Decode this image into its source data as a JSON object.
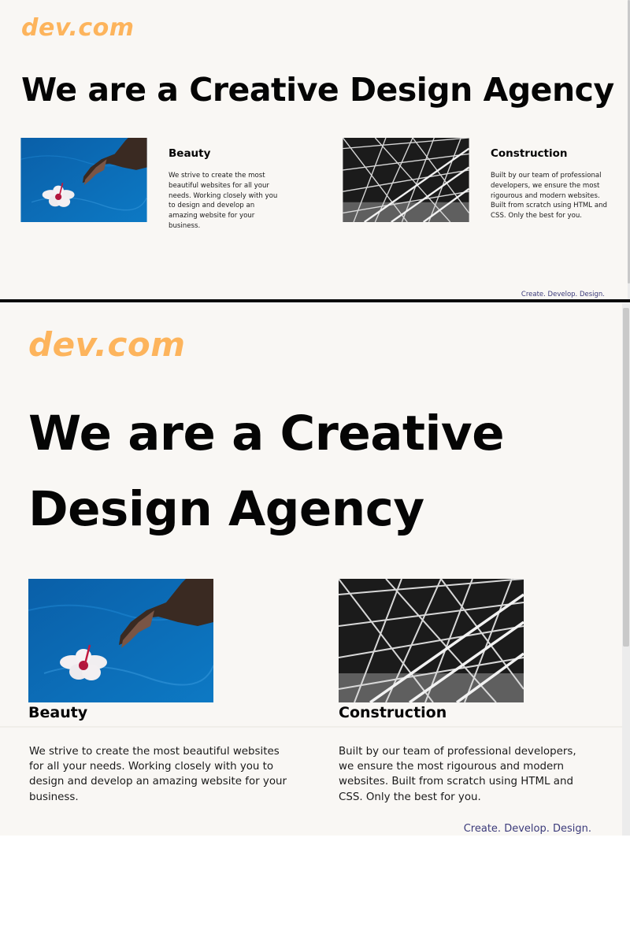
{
  "site": {
    "logo": "dev.com",
    "headline": "We are a Creative Design Agency",
    "tagline": "Create. Develop. Design.",
    "colors": {
      "logo": "#fdb45c",
      "background": "#f9f7f4",
      "tagline": "#3b3a7a"
    }
  },
  "cards": [
    {
      "title": "Beauty",
      "text": "We strive to create the most beautiful websites for all your needs. Working closely with you to design and develop an amazing website for your business.",
      "image": "hand-touching-water-with-hibiscus-flower-image"
    },
    {
      "title": "Construction",
      "text": "Built by our team of professional developers, we ensure the most rigourous and modern websites. Built from scratch using HTML and CSS. Only the best for you.",
      "image": "steel-lattice-structure-image"
    }
  ]
}
